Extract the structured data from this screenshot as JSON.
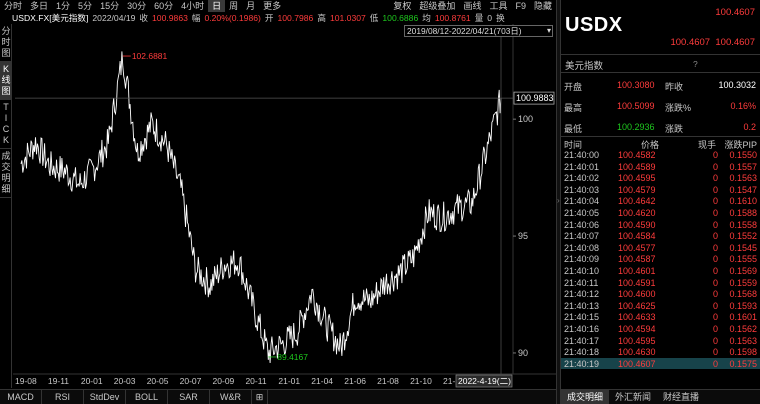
{
  "toolbar": {
    "periods": [
      "分时",
      "多日",
      "1分",
      "5分",
      "15分",
      "30分",
      "60分",
      "4小时",
      "日",
      "周",
      "月",
      "更多"
    ],
    "active_period_index": 8,
    "tools": [
      "复权",
      "超级叠加",
      "画线",
      "工具",
      "F9",
      "隐藏"
    ]
  },
  "infobar": {
    "symbol": "USDX.FX[美元指数]",
    "date": "2022/04/19",
    "close_label": "收",
    "close": "100.9863",
    "change_label": "幅",
    "change": "0.20%(0.1986)",
    "open_label": "开",
    "open": "100.7986",
    "high_label": "高",
    "high": "101.0307",
    "low_label": "低",
    "low": "100.6886",
    "avg_label": "均",
    "avg": "100.8761",
    "volume_label": "量",
    "volume": "0",
    "swap_label": "换"
  },
  "left_tabs": [
    {
      "label": [
        "分",
        "时",
        "图"
      ]
    },
    {
      "label": [
        "K",
        "线",
        "图"
      ]
    },
    {
      "label": [
        "T",
        "I",
        "C",
        "K"
      ]
    },
    {
      "label": [
        "成",
        "交",
        "明",
        "细"
      ]
    }
  ],
  "left_tab_active": 1,
  "range_selector": "2019/08/12-2022/04/21(703日)",
  "chart_data": {
    "type": "line",
    "x": [
      "2019-08",
      "2019-09",
      "2019-10",
      "2019-11",
      "2019-12",
      "2020-01",
      "2020-02",
      "2020-03a",
      "2020-03b",
      "2020-04",
      "2020-05",
      "2020-06",
      "2020-07",
      "2020-08",
      "2020-09",
      "2020-10",
      "2020-11",
      "2020-12",
      "2021-01",
      "2021-02",
      "2021-03",
      "2021-04",
      "2021-05",
      "2021-06",
      "2021-07",
      "2021-08",
      "2021-09",
      "2021-10",
      "2021-11",
      "2021-12",
      "2022-01",
      "2022-02",
      "2022-03",
      "2022-04"
    ],
    "values": [
      98.1,
      99.0,
      98.0,
      97.8,
      97.2,
      97.9,
      99.0,
      102.7,
      98.6,
      99.8,
      98.9,
      97.0,
      93.6,
      92.9,
      93.8,
      93.9,
      91.9,
      90.0,
      90.4,
      90.9,
      92.6,
      91.2,
      90.2,
      92.4,
      92.2,
      93.0,
      93.4,
      94.1,
      96.0,
      95.8,
      96.2,
      96.4,
      98.6,
      100.9
    ],
    "series_color": "#ffffff",
    "y_ticks": [
      100,
      95,
      90
    ],
    "ylim": [
      89.1,
      103.3
    ],
    "x_tick_labels": [
      "19-08",
      "19-11",
      "20-01",
      "20-03",
      "20-05",
      "20-07",
      "20-09",
      "20-11",
      "21-01",
      "21-04",
      "21-06",
      "21-08",
      "21-10",
      "21-12"
    ],
    "current_x_label": "2022-4-19(二)",
    "last_price_label": "100.9883",
    "max_label": "102.6881",
    "min_label": "89.4167",
    "grid": false
  },
  "bottom_tabs": [
    "MACD",
    "RSI",
    "StdDev",
    "BOLL",
    "SAR",
    "W&R",
    "⊞"
  ],
  "panel": {
    "symbol": "USDX",
    "last": "100.4607",
    "bid": "100.4607",
    "ask": "100.4607",
    "name": "美元指数",
    "help": "?",
    "quotes": [
      [
        {
          "label": "开盘",
          "value": "100.3080"
        },
        {
          "label": "昨收",
          "value": "100.3032"
        }
      ],
      [
        {
          "label": "最高",
          "value": "100.5099"
        },
        {
          "label": "涨跌%",
          "value": "0.16%"
        }
      ],
      [
        {
          "label": "最低",
          "value": "100.2936"
        },
        {
          "label": "涨跌",
          "value": "0.2"
        }
      ]
    ],
    "table_headers": [
      "时间",
      "价格",
      "现手",
      "涨跌PIP"
    ],
    "ticks": [
      [
        "21:40:00",
        "100.4582",
        "0",
        "0.1550"
      ],
      [
        "21:40:01",
        "100.4589",
        "0",
        "0.1557"
      ],
      [
        "21:40:02",
        "100.4595",
        "0",
        "0.1563"
      ],
      [
        "21:40:03",
        "100.4579",
        "0",
        "0.1547"
      ],
      [
        "21:40:04",
        "100.4642",
        "0",
        "0.1610"
      ],
      [
        "21:40:05",
        "100.4620",
        "0",
        "0.1588"
      ],
      [
        "21:40:06",
        "100.4590",
        "0",
        "0.1558"
      ],
      [
        "21:40:07",
        "100.4584",
        "0",
        "0.1552"
      ],
      [
        "21:40:08",
        "100.4577",
        "0",
        "0.1545"
      ],
      [
        "21:40:09",
        "100.4587",
        "0",
        "0.1555"
      ],
      [
        "21:40:10",
        "100.4601",
        "0",
        "0.1569"
      ],
      [
        "21:40:11",
        "100.4591",
        "0",
        "0.1559"
      ],
      [
        "21:40:12",
        "100.4600",
        "0",
        "0.1568"
      ],
      [
        "21:40:13",
        "100.4625",
        "0",
        "0.1593"
      ],
      [
        "21:40:15",
        "100.4633",
        "0",
        "0.1601"
      ],
      [
        "21:40:16",
        "100.4594",
        "0",
        "0.1562"
      ],
      [
        "21:40:17",
        "100.4595",
        "0",
        "0.1563"
      ],
      [
        "21:40:18",
        "100.4630",
        "0",
        "0.1598"
      ],
      [
        "21:40:19",
        "100.4607",
        "0",
        "0.1575"
      ]
    ],
    "tabs": [
      "成交明细",
      "外汇新闻",
      "财经直播"
    ],
    "active_tab": 0
  },
  "colors": {
    "up": "#ff3c3c",
    "down": "#1ec81e",
    "highlight_row": "#17434a"
  }
}
